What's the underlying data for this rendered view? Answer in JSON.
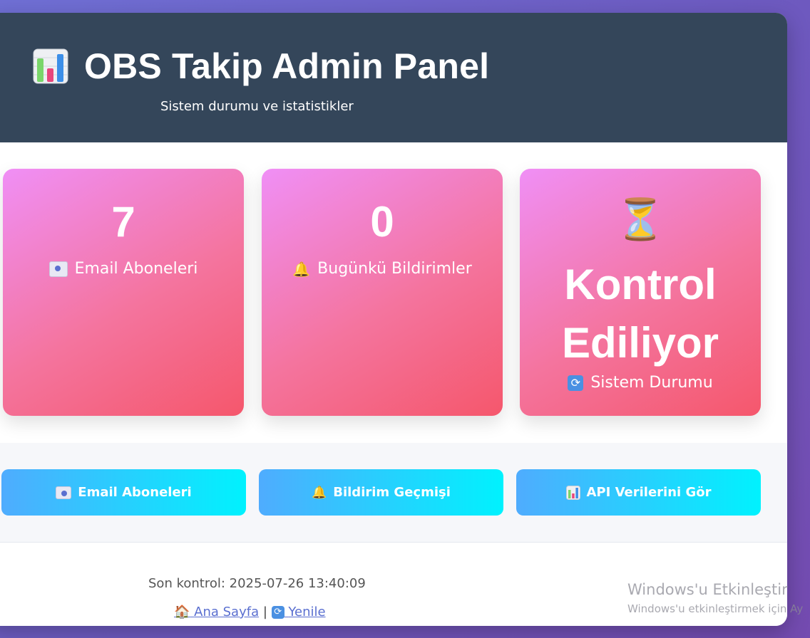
{
  "header": {
    "icon": "bar-chart-icon",
    "title": "OBS Takip Admin Panel",
    "subtitle": "Sistem durumu ve istatistikler"
  },
  "stats": [
    {
      "value": "7",
      "icon": "envelope-icon",
      "label": "Email Aboneleri"
    },
    {
      "value": "0",
      "icon": "bell-icon",
      "label": "Bugünkü Bildirimler"
    },
    {
      "icon": "hourglass-icon",
      "status_line1": "Kontrol",
      "status_line2": "Ediliyor",
      "label_icon": "refresh-icon",
      "label": "Sistem Durumu"
    }
  ],
  "actions": [
    {
      "icon": "envelope-icon",
      "label": "Email Aboneleri"
    },
    {
      "icon": "bell-icon",
      "label": "Bildirim Geçmişi"
    },
    {
      "icon": "bar-chart-icon",
      "label": "API Verilerini Gör"
    }
  ],
  "footer": {
    "last_check": "Son kontrol: 2025-07-26 13:40:09",
    "home_link": "Ana Sayfa",
    "separator": "|",
    "refresh_link": "Yenile"
  },
  "watermark": {
    "line1": "Windows'u Etkinleştir",
    "line2": "Windows'u etkinleştirmek için Ay"
  },
  "colors": {
    "header_bg": "#34465a",
    "card_gradient_start": "#f093fb",
    "card_gradient_end": "#f5576c",
    "button_gradient_start": "#4facfe",
    "button_gradient_end": "#00f2fe",
    "link": "#5a6fd0"
  }
}
